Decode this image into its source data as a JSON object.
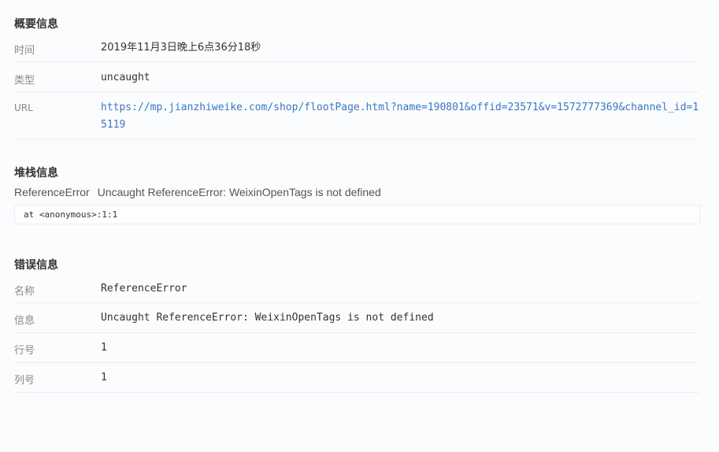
{
  "summary": {
    "title": "概要信息",
    "rows": [
      {
        "label": "时间",
        "value": "2019年11月3日晚上6点36分18秒"
      },
      {
        "label": "类型",
        "value": "uncaught"
      },
      {
        "label": "URL",
        "value": "https://mp.jianzhiweike.com/shop/flootPage.html?name=190801&offid=23571&v=1572777369&channel_id=15119"
      }
    ]
  },
  "stack": {
    "title": "堆栈信息",
    "error_name": "ReferenceError",
    "error_message": "Uncaught ReferenceError: WeixinOpenTags is not defined",
    "trace": "at <anonymous>:1:1"
  },
  "error": {
    "title": "错误信息",
    "rows": [
      {
        "label": "名称",
        "value": "ReferenceError"
      },
      {
        "label": "信息",
        "value": "Uncaught ReferenceError: WeixinOpenTags is not defined"
      },
      {
        "label": "行号",
        "value": "1"
      },
      {
        "label": "列号",
        "value": "1"
      }
    ]
  },
  "colors": {
    "link": "#3a76c4",
    "label": "#888888",
    "text": "#333333"
  }
}
